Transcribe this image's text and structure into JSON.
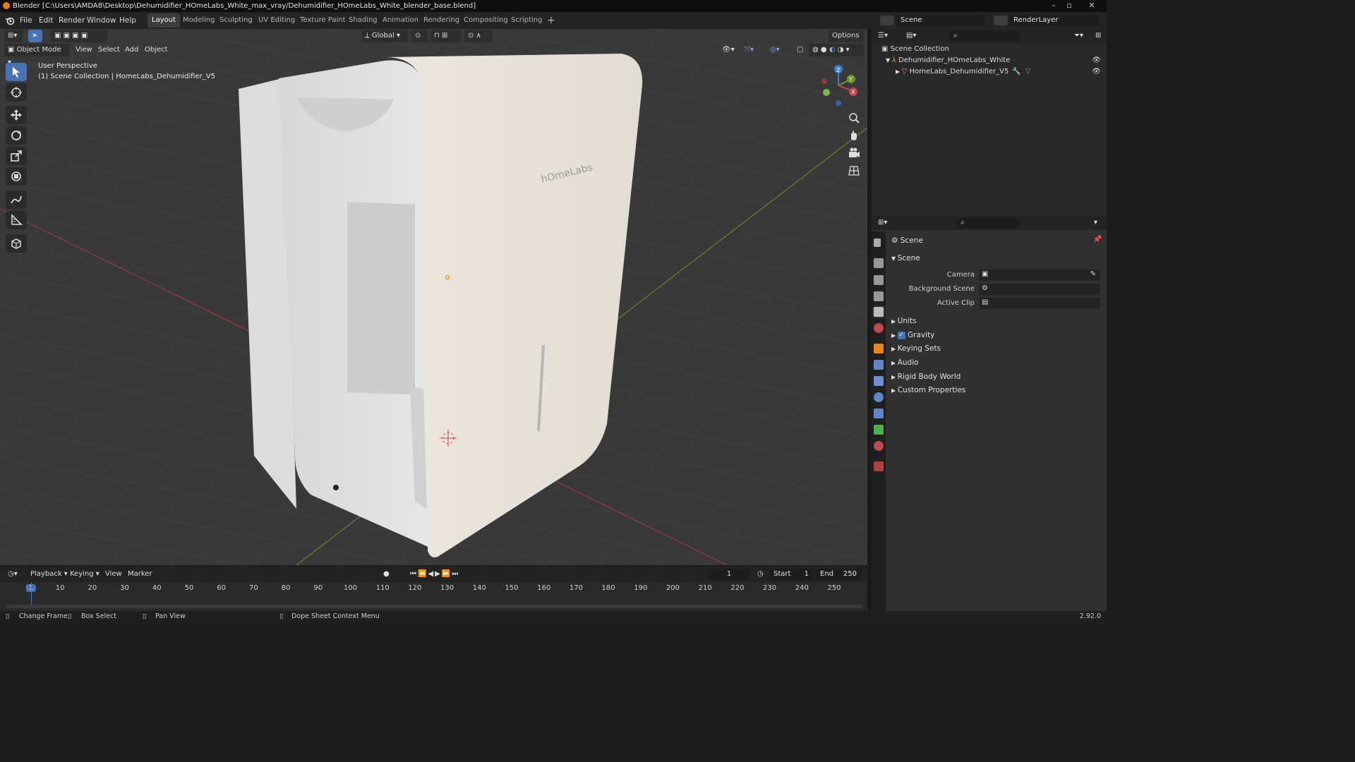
{
  "window": {
    "title": "Blender [C:\\Users\\AMDA8\\Desktop\\Dehumidifier_HOmeLabs_White_max_vray/Dehumidifier_HOmeLabs_White_blender_base.blend]"
  },
  "menus": [
    "File",
    "Edit",
    "Render",
    "Window",
    "Help"
  ],
  "workspaces": [
    "Layout",
    "Modeling",
    "Sculpting",
    "UV Editing",
    "Texture Paint",
    "Shading",
    "Animation",
    "Rendering",
    "Compositing",
    "Scripting"
  ],
  "active_workspace": "Layout",
  "scene_field": "Scene",
  "view_layer_field": "RenderLayer",
  "tool_header": {
    "orientation": "Global",
    "options": "Options"
  },
  "viewport_header": {
    "mode": "Object Mode",
    "menus": [
      "View",
      "Select",
      "Add",
      "Object"
    ]
  },
  "viewport": {
    "perspective": "User Perspective",
    "collection_info": "(1) Scene Collection | HomeLabs_Dehumidifier_V5",
    "model_brand_text": "hOmeLabs",
    "gizmo_axes": [
      "Z",
      "Y",
      "X"
    ]
  },
  "outliner": {
    "root": "Scene Collection",
    "items": [
      {
        "label": "Dehumidifier_HOmeLabs_White"
      },
      {
        "label": "HomeLabs_Dehumidifier_V5"
      }
    ]
  },
  "properties": {
    "context": "Scene",
    "panel": "Scene",
    "fields": [
      {
        "label": "Camera"
      },
      {
        "label": "Background Scene"
      },
      {
        "label": "Active Clip"
      }
    ],
    "subpanels": [
      "Units",
      "Gravity",
      "Keying Sets",
      "Audio",
      "Rigid Body World",
      "Custom Properties"
    ],
    "gravity_checked": true
  },
  "timeline": {
    "menus": [
      "Playback",
      "Keying",
      "View",
      "Marker"
    ],
    "current_frame": "1",
    "start_label": "Start",
    "start": "1",
    "end_label": "End",
    "end": "250",
    "ticks": [
      "1",
      "10",
      "20",
      "30",
      "40",
      "50",
      "60",
      "70",
      "80",
      "90",
      "100",
      "110",
      "120",
      "130",
      "140",
      "150",
      "160",
      "170",
      "180",
      "190",
      "200",
      "210",
      "220",
      "230",
      "240",
      "250"
    ]
  },
  "statusbar": {
    "items": [
      "Change Frame",
      "Box Select",
      "Pan View",
      "Dope Sheet Context Menu"
    ],
    "version": "2.92.0"
  },
  "colors": {
    "accent": "#4772b3",
    "blender_orange": "#e87d0d",
    "x_axis": "#c8424b",
    "y_axis": "#6b9a2a",
    "z_axis": "#3a7fd1"
  }
}
